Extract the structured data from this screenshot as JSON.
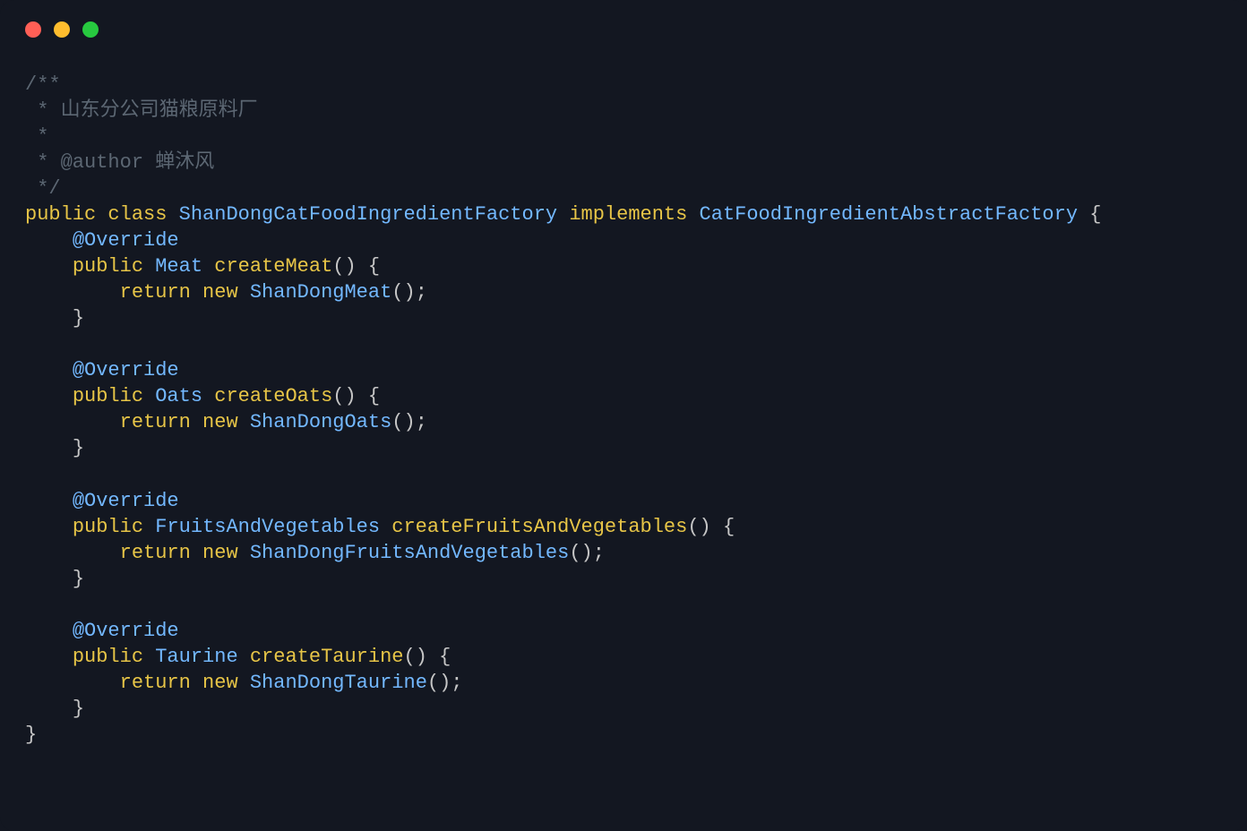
{
  "colors": {
    "bg": "#131721",
    "comment": "#5c6773",
    "keyword": "#e7c547",
    "type": "#73b8ff",
    "punct": "#c6c6c6"
  },
  "comment": {
    "open": "/**",
    "line1": " * 山东分公司猫粮原料厂",
    "line2": " *",
    "line3": " * @author 蝉沐风",
    "close": " */"
  },
  "decl": {
    "public": "public",
    "class": "class",
    "className": "ShanDongCatFoodIngredientFactory",
    "implements": "implements",
    "interfaceName": "CatFoodIngredientAbstractFactory",
    "openBrace": " {",
    "closeBrace": "}"
  },
  "methods": [
    {
      "override": "@Override",
      "public": "public",
      "returnType": "Meat",
      "name": "createMeat",
      "sig": "() {",
      "returnKw": "return",
      "newKw": "new",
      "newType": "ShanDongMeat",
      "tail": "();",
      "closeBrace": "}"
    },
    {
      "override": "@Override",
      "public": "public",
      "returnType": "Oats",
      "name": "createOats",
      "sig": "() {",
      "returnKw": "return",
      "newKw": "new",
      "newType": "ShanDongOats",
      "tail": "();",
      "closeBrace": "}"
    },
    {
      "override": "@Override",
      "public": "public",
      "returnType": "FruitsAndVegetables",
      "name": "createFruitsAndVegetables",
      "sig": "() {",
      "returnKw": "return",
      "newKw": "new",
      "newType": "ShanDongFruitsAndVegetables",
      "tail": "();",
      "closeBrace": "}"
    },
    {
      "override": "@Override",
      "public": "public",
      "returnType": "Taurine",
      "name": "createTaurine",
      "sig": "() {",
      "returnKw": "return",
      "newKw": "new",
      "newType": "ShanDongTaurine",
      "tail": "();",
      "closeBrace": "}"
    }
  ]
}
